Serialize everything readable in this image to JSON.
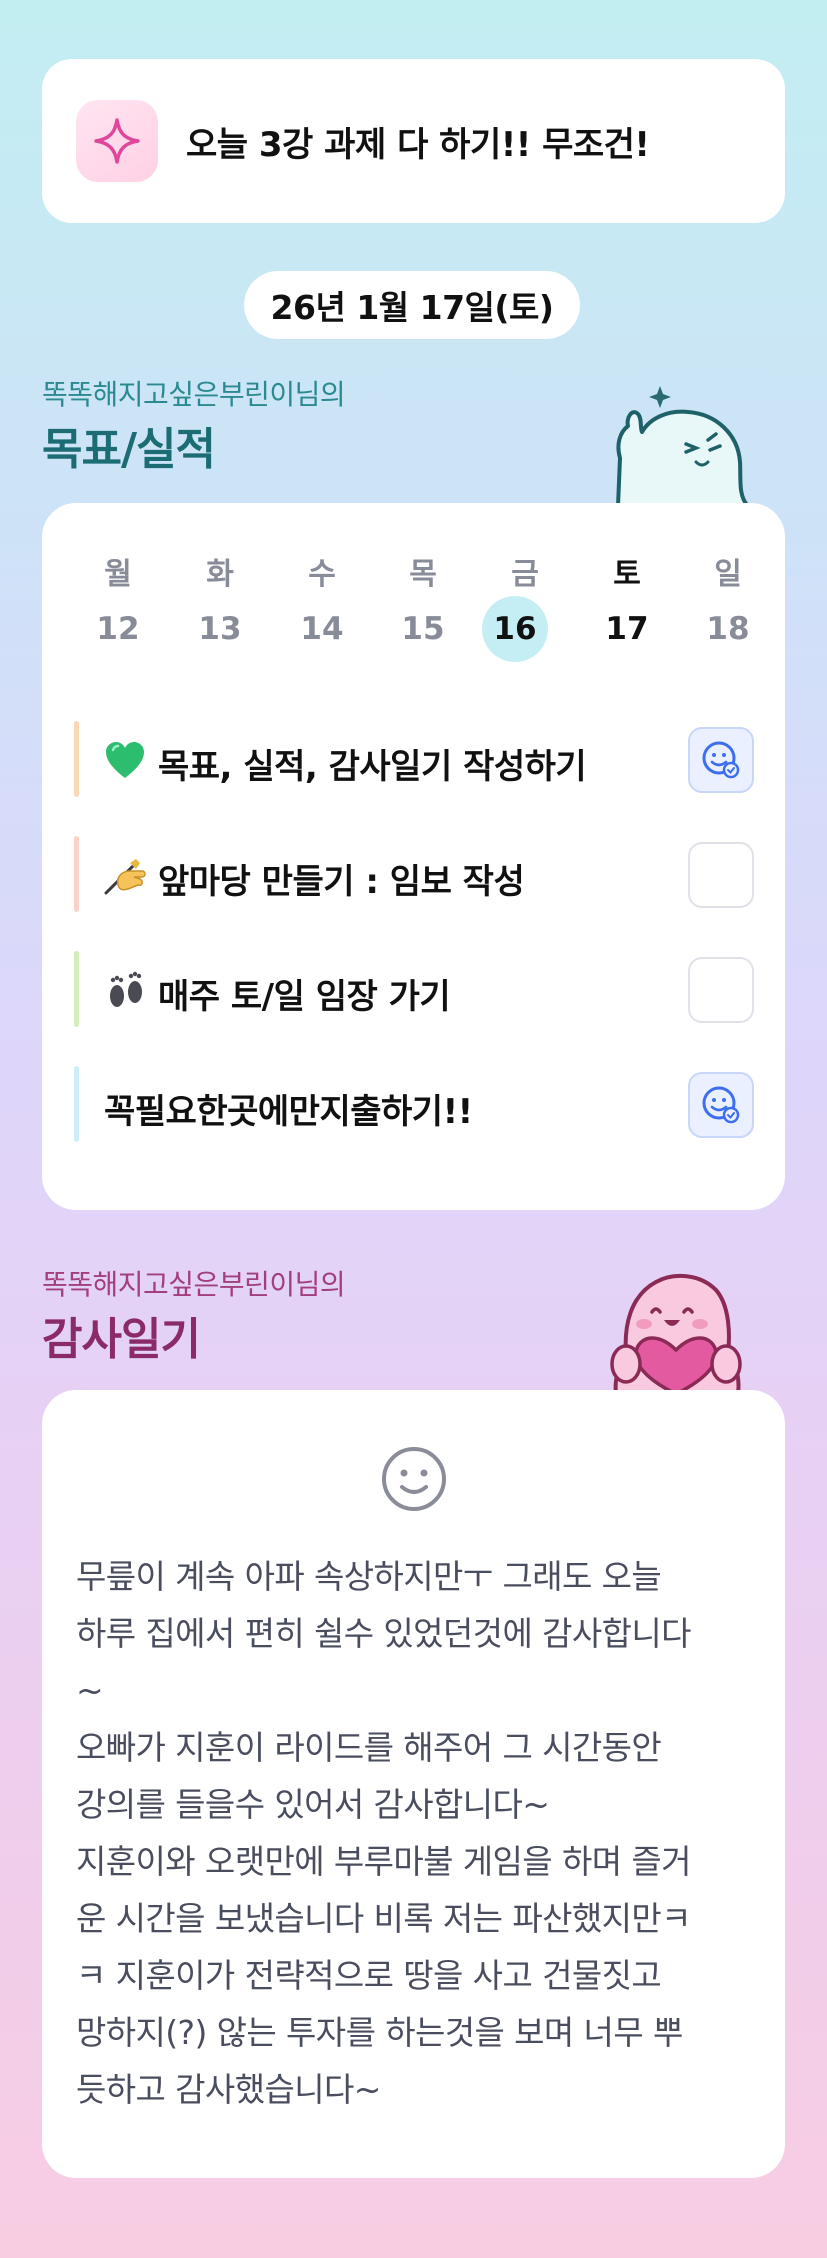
{
  "banner": {
    "icon": "sparkle-icon",
    "text": "오늘 3강 과제 다 하기!! 무조건!"
  },
  "date": "26년 1월 17일(토)",
  "goals_section": {
    "subtitle": "똑똑해지고싶은부린이님의",
    "title": "목표/실적",
    "subtitle_color": "#2b8a8f",
    "title_color": "#1c6d73"
  },
  "week": {
    "days": [
      {
        "name": "월",
        "num": "12"
      },
      {
        "name": "화",
        "num": "13"
      },
      {
        "name": "수",
        "num": "14"
      },
      {
        "name": "목",
        "num": "15"
      },
      {
        "name": "금",
        "num": "16"
      },
      {
        "name": "토",
        "num": "17"
      },
      {
        "name": "일",
        "num": "18"
      }
    ],
    "today_num": "16",
    "selected_day": "토"
  },
  "tasks": [
    {
      "emoji": "green-heart-icon",
      "label": "목표, 실적, 감사일기 작성하기",
      "done": true,
      "bar_color": "#f9d9b3"
    },
    {
      "emoji": "writing-hand-icon",
      "label": "앞마당 만들기 : 임보 작성",
      "done": false,
      "bar_color": "#f9d3c6"
    },
    {
      "emoji": "footprints-icon",
      "label": "매주 토/일 임장 가기",
      "done": false,
      "bar_color": "#d4edb9"
    },
    {
      "emoji": "",
      "label": "꼭필요한곳에만지출하기!!",
      "done": true,
      "bar_color": "#cdeef8"
    }
  ],
  "gratitude_section": {
    "subtitle": "똑똑해지고싶은부린이님의",
    "title": "감사일기",
    "subtitle_color": "#a33f7a",
    "title_color": "#8a2a66"
  },
  "diary": {
    "icon": "smiley-face-icon",
    "lines": [
      "무릎이 계속 아파 속상하지만ㅜ 그래도 오늘",
      "하루 집에서 편히 쉴수 있었던것에 감사합니다",
      "~",
      "오빠가 지훈이 라이드를 해주어 그 시간동안",
      "강의를 들을수 있어서 감사합니다~",
      "지훈이와 오랫만에 부루마불 게임을 하며 즐거",
      "운 시간을 보냈습니다 비록 저는 파산했지만ㅋ",
      "ㅋ 지훈이가 전략적으로 땅을 사고 건물짓고",
      "망하지(?) 않는 투자를 하는것을 보며 너무 뿌",
      "듯하고 감사했습니다~"
    ]
  }
}
